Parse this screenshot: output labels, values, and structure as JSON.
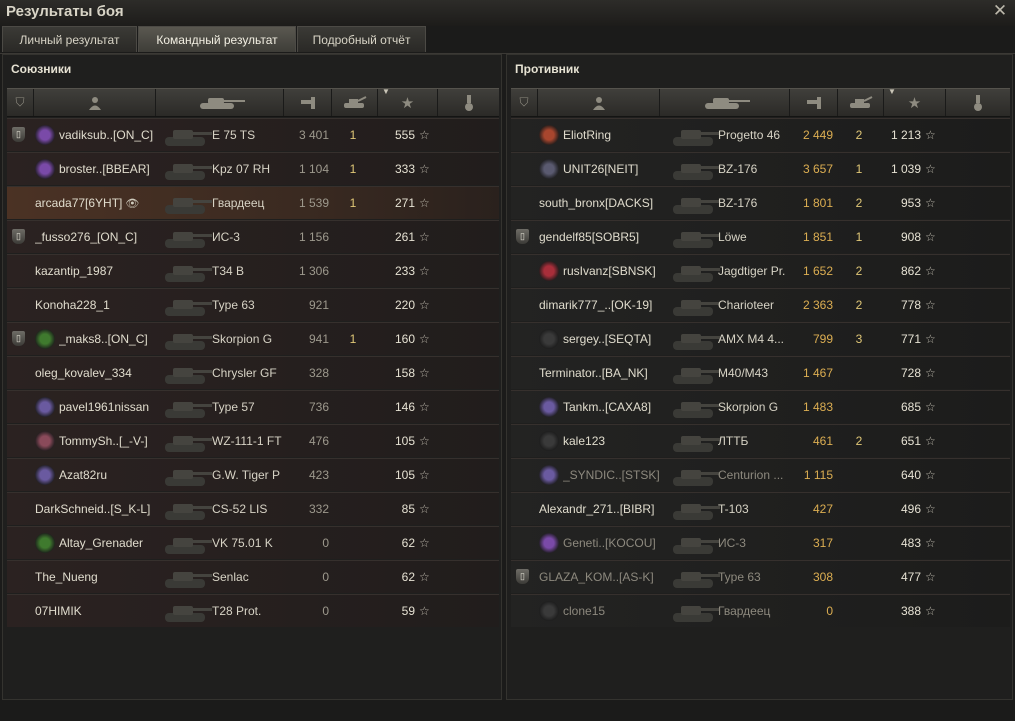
{
  "window": {
    "title": "Результаты боя"
  },
  "tabs": [
    {
      "label": "Личный результат"
    },
    {
      "label": "Командный результат"
    },
    {
      "label": "Подробный отчёт"
    }
  ],
  "colors": {
    "accent": "#dcae52",
    "ally_row": "#2b2221",
    "highlight_row": "#4b3224",
    "enemy_row": "#232322"
  },
  "allies": {
    "title": "Союзники",
    "rows": [
      {
        "name": "vadiksub..[ON_C]",
        "vehicle": "E 75 TS",
        "damage": "3 401",
        "kills": "1",
        "xp": "555",
        "squad": true,
        "clan": "#7a4aa8",
        "star": "☆"
      },
      {
        "name": "broster..[BBEAR]",
        "vehicle": "Kpz 07 RH",
        "damage": "1 104",
        "kills": "1",
        "xp": "333",
        "squad": false,
        "clan": "#7a4aa8",
        "star": "☆"
      },
      {
        "name": "arcada77[6YHT]",
        "vehicle": "Гвардеец",
        "damage": "1 539",
        "kills": "1",
        "xp": "271",
        "squad": false,
        "clan": "",
        "star": "☆",
        "highlight": true,
        "eye": "👁"
      },
      {
        "name": "_fusso276_[ON_C]",
        "vehicle": "ИС-3",
        "damage": "1 156",
        "kills": "",
        "xp": "261",
        "squad": true,
        "clan": "",
        "star": "☆"
      },
      {
        "name": "kazantip_1987",
        "vehicle": "T34 B",
        "damage": "1 306",
        "kills": "",
        "xp": "233",
        "squad": false,
        "clan": "",
        "star": "☆"
      },
      {
        "name": "Konoha228_1",
        "vehicle": "Type 63",
        "damage": "921",
        "kills": "",
        "xp": "220",
        "squad": false,
        "clan": "",
        "star": "☆"
      },
      {
        "name": "_maks8..[ON_C]",
        "vehicle": "Skorpion G",
        "damage": "941",
        "kills": "1",
        "xp": "160",
        "squad": true,
        "clan": "#3f7a2e",
        "star": "☆"
      },
      {
        "name": "oleg_kovalev_334",
        "vehicle": "Chrysler GF",
        "damage": "328",
        "kills": "",
        "xp": "158",
        "squad": false,
        "clan": "",
        "star": "☆"
      },
      {
        "name": "pavel1961nissan",
        "vehicle": "Type 57",
        "damage": "736",
        "kills": "",
        "xp": "146",
        "squad": false,
        "clan": "#6a5aa0",
        "star": "☆"
      },
      {
        "name": "TommySh..[_-V-]",
        "vehicle": "WZ-111-1 FT",
        "damage": "476",
        "kills": "",
        "xp": "105",
        "squad": false,
        "clan": "#8a4a5a",
        "star": "☆"
      },
      {
        "name": "Azat82ru",
        "vehicle": "G.W. Tiger P",
        "damage": "423",
        "kills": "",
        "xp": "105",
        "squad": false,
        "clan": "#6a5aa0",
        "star": "☆"
      },
      {
        "name": "DarkSchneid..[S_K-L]",
        "vehicle": "CS-52 LIS",
        "damage": "332",
        "kills": "",
        "xp": "85",
        "squad": false,
        "clan": "",
        "star": "☆"
      },
      {
        "name": "Altay_Grenader",
        "vehicle": "VK 75.01 K",
        "damage": "0",
        "kills": "",
        "xp": "62",
        "squad": false,
        "clan": "#3f7a2e",
        "star": "☆"
      },
      {
        "name": "The_Nueng",
        "vehicle": "Senlac",
        "damage": "0",
        "kills": "",
        "xp": "62",
        "squad": false,
        "clan": "",
        "star": "☆"
      },
      {
        "name": "07HIMIK",
        "vehicle": "T28 Prot.",
        "damage": "0",
        "kills": "",
        "xp": "59",
        "squad": false,
        "clan": "",
        "star": "☆"
      }
    ]
  },
  "enemies": {
    "title": "Противник",
    "rows": [
      {
        "name": "EliotRing",
        "vehicle": "Progetto 46",
        "damage": "2 449",
        "kills": "2",
        "xp": "1 213",
        "squad": false,
        "clan": "#a8462e",
        "star": "☆"
      },
      {
        "name": "UNIT26[NEIT]",
        "vehicle": "BZ-176",
        "damage": "3 657",
        "kills": "1",
        "xp": "1 039",
        "squad": false,
        "clan": "#5a5a70",
        "star": "☆"
      },
      {
        "name": "south_bronx[DACKS]",
        "vehicle": "BZ-176",
        "damage": "1 801",
        "kills": "2",
        "xp": "953",
        "squad": false,
        "clan": "",
        "star": "☆"
      },
      {
        "name": "gendelf85[SOBR5]",
        "vehicle": "Löwe",
        "damage": "1 851",
        "kills": "1",
        "xp": "908",
        "squad": true,
        "clan": "",
        "star": "☆"
      },
      {
        "name": "rusIvanz[SBNSK]",
        "vehicle": "Jagdtiger Pr.",
        "damage": "1 652",
        "kills": "2",
        "xp": "862",
        "squad": false,
        "clan": "#a82e3a",
        "star": "☆"
      },
      {
        "name": "dimarik777_..[OK-19]",
        "vehicle": "Charioteer",
        "damage": "2 363",
        "kills": "2",
        "xp": "778",
        "squad": false,
        "clan": "",
        "star": "☆"
      },
      {
        "name": "sergey..[SEQTA]",
        "vehicle": "AMX M4 4...",
        "damage": "799",
        "kills": "3",
        "xp": "771",
        "squad": false,
        "clan": "#3a3a3a",
        "star": "☆"
      },
      {
        "name": "Terminator..[BA_NK]",
        "vehicle": "M40/M43",
        "damage": "1 467",
        "kills": "",
        "xp": "728",
        "squad": false,
        "clan": "",
        "star": "☆"
      },
      {
        "name": "Tankm..[CAXA8]",
        "vehicle": "Skorpion G",
        "damage": "1 483",
        "kills": "",
        "xp": "685",
        "squad": false,
        "clan": "#6a5aa0",
        "star": "☆"
      },
      {
        "name": "kale123",
        "vehicle": "ЛТТБ",
        "damage": "461",
        "kills": "2",
        "xp": "651",
        "squad": false,
        "clan": "#3a3a3a",
        "star": "☆"
      },
      {
        "name": "_SYNDIC..[STSK]",
        "vehicle": "Centurion ...",
        "damage": "1 115",
        "kills": "",
        "xp": "640",
        "squad": false,
        "clan": "#6a5aa0",
        "star": "☆",
        "dead": true
      },
      {
        "name": "Alexandr_271..[BIBR]",
        "vehicle": "T-103",
        "damage": "427",
        "kills": "",
        "xp": "496",
        "squad": false,
        "clan": "",
        "star": "☆"
      },
      {
        "name": "Geneti..[KOCOU]",
        "vehicle": "ИС-3",
        "damage": "317",
        "kills": "",
        "xp": "483",
        "squad": false,
        "clan": "#7a4aa8",
        "star": "☆",
        "dead": true
      },
      {
        "name": "GLAZA_KOM..[AS-K]",
        "vehicle": "Type 63",
        "damage": "308",
        "kills": "",
        "xp": "477",
        "squad": true,
        "clan": "",
        "star": "☆",
        "dead": true
      },
      {
        "name": "clone15",
        "vehicle": "Гвардеец",
        "damage": "0",
        "kills": "",
        "xp": "388",
        "squad": false,
        "clan": "#3a3a3a",
        "star": "☆",
        "dead": true
      }
    ]
  }
}
